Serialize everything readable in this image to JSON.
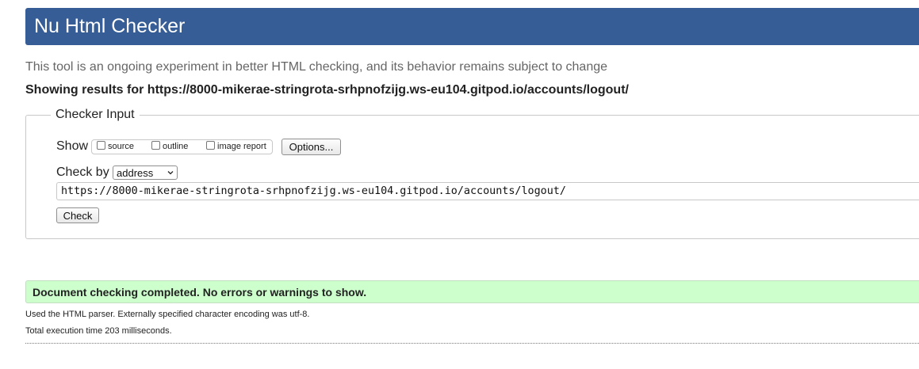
{
  "header": {
    "title": "Nu Html Checker"
  },
  "tagline": "This tool is an ongoing experiment in better HTML checking, and its behavior remains subject to change",
  "results_for": "Showing results for https://8000-mikerae-stringrota-srhpnofzijg.ws-eu104.gitpod.io/accounts/logout/",
  "checker_input": {
    "legend": "Checker Input",
    "show_label": "Show",
    "show_options": [
      {
        "label": "source",
        "checked": false
      },
      {
        "label": "outline",
        "checked": false
      },
      {
        "label": "image report",
        "checked": false
      }
    ],
    "options_button": "Options...",
    "check_by_label": "Check by",
    "check_by_value": "address",
    "url_value": "https://8000-mikerae-stringrota-srhpnofzijg.ws-eu104.gitpod.io/accounts/logout/",
    "check_button": "Check"
  },
  "result": {
    "success_message": "Document checking completed. No errors or warnings to show.",
    "parser_note": "Used the HTML parser. Externally specified character encoding was utf-8.",
    "execution_time": "Total execution time 203 milliseconds."
  },
  "colors": {
    "header_bg": "#365d95",
    "success_bg": "#ccffcc"
  }
}
